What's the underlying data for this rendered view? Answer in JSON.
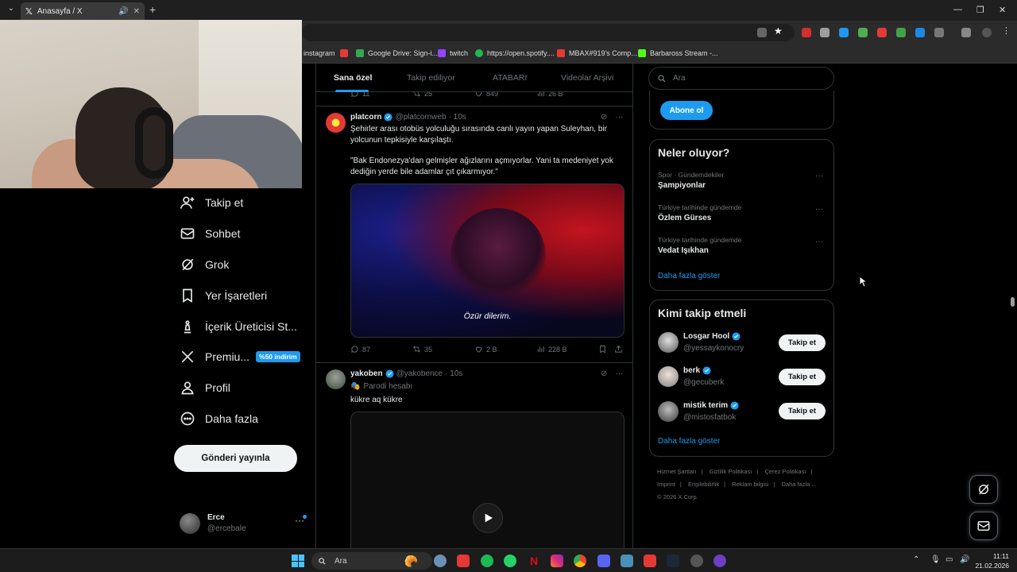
{
  "browser": {
    "tab_title": "Anasayfa / X",
    "bookmarks": [
      {
        "label": "instagram",
        "color": "#e1306c"
      },
      {
        "label": "Google Drive: Sign-i...",
        "color": "#34a853"
      },
      {
        "label": "twitch",
        "color": "#9146ff"
      },
      {
        "label": "https://open.spotify....",
        "color": "#1db954"
      },
      {
        "label": "MBAX#919's Comp...",
        "color": "#e53935"
      },
      {
        "label": "Barbaross Stream -...",
        "color": "#53fc18"
      }
    ]
  },
  "nav": {
    "items": [
      {
        "label": "Takip et",
        "icon": "add-user-icon"
      },
      {
        "label": "Sohbet",
        "icon": "mail-icon"
      },
      {
        "label": "Grok",
        "icon": "grok-icon"
      },
      {
        "label": "Yer İşaretleri",
        "icon": "bookmark-icon"
      },
      {
        "label": "İçerik Üreticisi St...",
        "icon": "creator-studio-icon"
      },
      {
        "label": "Premiu...",
        "icon": "x-logo-icon",
        "badge": "%50 indirim"
      },
      {
        "label": "Profil",
        "icon": "profile-icon"
      },
      {
        "label": "Daha fazla",
        "icon": "more-circle-icon"
      }
    ],
    "post_button": "Gönderi yayınla",
    "account": {
      "name": "Erce",
      "handle": "@ercebale"
    }
  },
  "main": {
    "tabs": [
      "Sana özel",
      "Takip ediliyor",
      "ATABARI",
      "Videolar Arşivi"
    ],
    "prev_actions": {
      "replies": "11",
      "reposts": "25",
      "likes": "849",
      "views": "26 B"
    },
    "tweets": [
      {
        "name": "platcorn",
        "handle": "@platcornweb",
        "time": "· 10s",
        "text1": "Şehirler arası otobüs yolculuğu sırasında canlı yayın yapan Suleyhan, bir yolcunun tepkisiyle karşılaştı.",
        "text2": "\"Bak Endonezya'dan gelmişler ağızlarını açmıyorlar. Yani ta medeniyet yok dediğin yerde bile adamlar çıt çıkarmıyor.\"",
        "subtitle": "Özür dilerim.",
        "replies": "87",
        "reposts": "35",
        "likes": "2 B",
        "views": "228 B"
      },
      {
        "name": "yakoben",
        "handle": "@yakobence",
        "time": "· 10s",
        "label": "Parodi hesabı",
        "text": "kükre aq kükre"
      }
    ]
  },
  "sidebar": {
    "search_placeholder": "Ara",
    "subscribe_button": "Abone ol",
    "trends_title": "Neler oluyor?",
    "trends": [
      {
        "meta": "Spor · Gündemdekiler",
        "name": "Şampiyonlar"
      },
      {
        "meta": "Türkiye tarihinde gündemde",
        "name": "Özlem Gürses"
      },
      {
        "meta": "Türkiye tarihinde gündemde",
        "name": "Vedat Işıkhan"
      }
    ],
    "show_more": "Daha fazla göster",
    "who_title": "Kimi takip etmeli",
    "who": [
      {
        "name": "Losgar Hool",
        "handle": "@yessaykonocry"
      },
      {
        "name": "berk",
        "handle": "@gecuberk"
      },
      {
        "name": "mistik terim",
        "handle": "@mistosfatbok"
      }
    ],
    "follow_label": "Takip et",
    "footer": [
      "Hizmet Şartları",
      "|",
      "Gizlilik Politikası",
      "|",
      "Çerez Politikası",
      "|",
      "Imprint",
      "|",
      "Erişilebilirlik",
      "|",
      "Reklam bilgisi",
      "|",
      "Daha fazla ...",
      "© 2026 X Corp."
    ]
  },
  "taskbar": {
    "search": "Ara",
    "time": "11:11",
    "date": "21.02.2026"
  },
  "colors": {
    "accent": "#1d9bf0",
    "background": "#000000",
    "border": "#2f3336"
  }
}
